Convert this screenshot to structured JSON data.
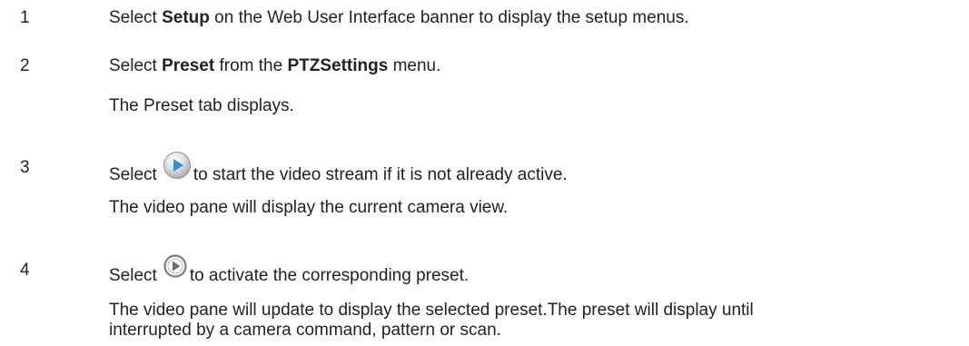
{
  "steps": [
    {
      "number": "1",
      "pre": "Select ",
      "bold": "Setup",
      "post": " on the Web User Interface banner to display the setup menus."
    },
    {
      "number": "2",
      "pre": "Select ",
      "bold": "Preset",
      "mid": " from the ",
      "bold2": "PTZSettings",
      "post": " menu.",
      "result": "The Preset tab displays."
    },
    {
      "number": "3",
      "pre": "Select",
      "icon": "play-button-icon",
      "post": "to start the video stream if it is not already active.",
      "result": "The video pane will display the current camera view."
    },
    {
      "number": "4",
      "pre": "Select",
      "icon": "activate-preset-icon",
      "post": "to activate the corresponding preset.",
      "result_line1": "The video pane will update to display the selected preset.The preset will display until",
      "result_line2": "interrupted by a camera command, pattern or scan."
    }
  ]
}
